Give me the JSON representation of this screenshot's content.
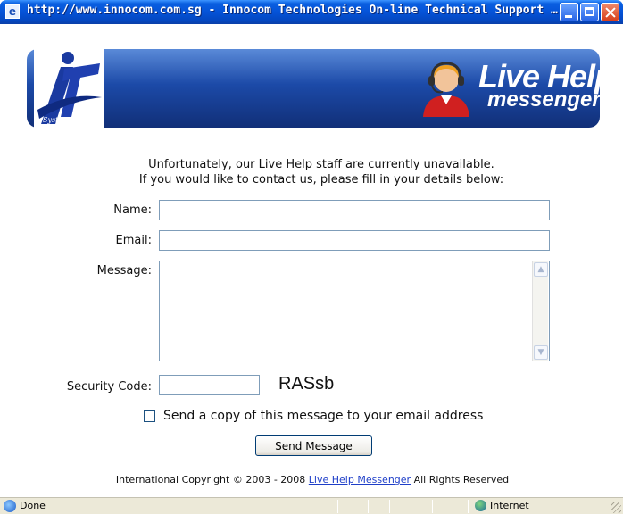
{
  "window": {
    "title": "http://www.innocom.com.sg - Innocom Technologies On-line Technical Support - Mi..."
  },
  "banner": {
    "logo_text": "System",
    "brand_title": "Live Help",
    "brand_subtitle": "messenger"
  },
  "notice": {
    "line1": "Unfortunately, our Live Help staff are currently unavailable.",
    "line2": "If you would like to contact us, please fill in your details below:"
  },
  "form": {
    "name_label": "Name:",
    "name_value": "",
    "email_label": "Email:",
    "email_value": "",
    "message_label": "Message:",
    "message_value": "",
    "security_label": "Security Code:",
    "security_value": "",
    "captcha_text": "RASsb",
    "copy_checkbox_label": "Send a copy of this message to your email address",
    "copy_checked": false,
    "send_button": "Send Message"
  },
  "footer": {
    "prefix": "International Copyright © 2003 - 2008",
    "link_text": "Live Help Messenger",
    "suffix": "All Rights Reserved"
  },
  "statusbar": {
    "status_text": "Done",
    "zone_text": "Internet"
  },
  "colors": {
    "titlebar": "#0553d8",
    "banner": "#1c4aa8",
    "link": "#1e3ec8",
    "statusbar": "#ece9d8"
  },
  "icons": {
    "window": "ie-page-icon",
    "minimize": "minimize-icon",
    "maximize": "maximize-icon",
    "close": "close-icon",
    "agent": "support-agent-headset-icon",
    "status": "ie-page-icon",
    "zone": "internet-globe-icon"
  }
}
